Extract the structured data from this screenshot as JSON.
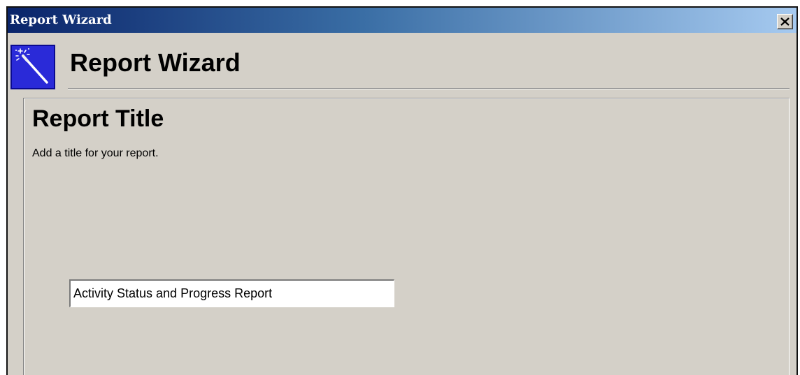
{
  "window": {
    "title": "Report Wizard",
    "close_label": "X"
  },
  "header": {
    "title": "Report Wizard",
    "icon": "magic-wand-icon"
  },
  "step": {
    "title": "Report Title",
    "description": "Add a title for your report.",
    "report_title_value": "Activity Status and Progress Report"
  },
  "colors": {
    "titlebar_start": "#0a246a",
    "titlebar_end": "#a6caf0",
    "face": "#d4d0c8",
    "icon_tile": "#2a2ad8"
  }
}
